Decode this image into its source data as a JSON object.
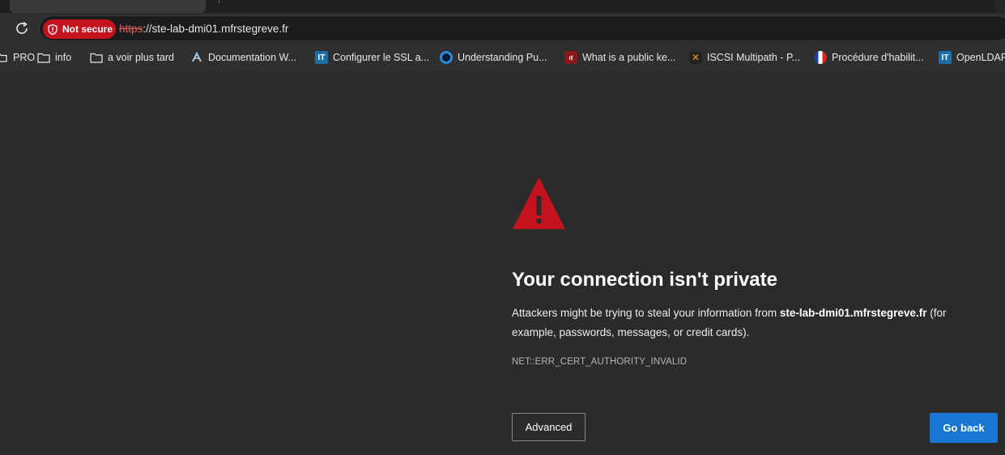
{
  "toolbar": {
    "security_badge": "Not secure",
    "url_scheme": "https",
    "url_rest": "://ste-lab-dmi01.mfrstegreve.fr"
  },
  "bookmarks": [
    {
      "label": "PRO",
      "icon": "folder-icon"
    },
    {
      "label": "info",
      "icon": "folder-icon"
    },
    {
      "label": "a voir plus tard",
      "icon": "folder-icon"
    },
    {
      "label": "Documentation W...",
      "icon": "doc-site-icon"
    },
    {
      "label": "Configurer le SSL a...",
      "icon": "it-site-icon"
    },
    {
      "label": "Understanding Pu...",
      "icon": "circle-site-icon"
    },
    {
      "label": "What is a public ke...",
      "icon": "red-site-icon"
    },
    {
      "label": "ISCSI Multipath - P...",
      "icon": "x-site-icon"
    },
    {
      "label": "Procédure d'habilit...",
      "icon": "fr-site-icon"
    },
    {
      "label": "OpenLDAP",
      "icon": "it-site-icon"
    }
  ],
  "page": {
    "title": "Your connection isn't private",
    "desc_before": "Attackers might be trying to steal your information from ",
    "desc_host": "ste-lab-dmi01.mfrstegreve.fr",
    "desc_after": " (for example, passwords, messages, or credit cards).",
    "error_code": "NET::ERR_CERT_AUTHORITY_INVALID",
    "advanced_label": "Advanced",
    "go_back_label": "Go back"
  },
  "colors": {
    "warning_red": "#c4131f",
    "primary_button": "#1976d2",
    "background": "#2b2b2b"
  }
}
